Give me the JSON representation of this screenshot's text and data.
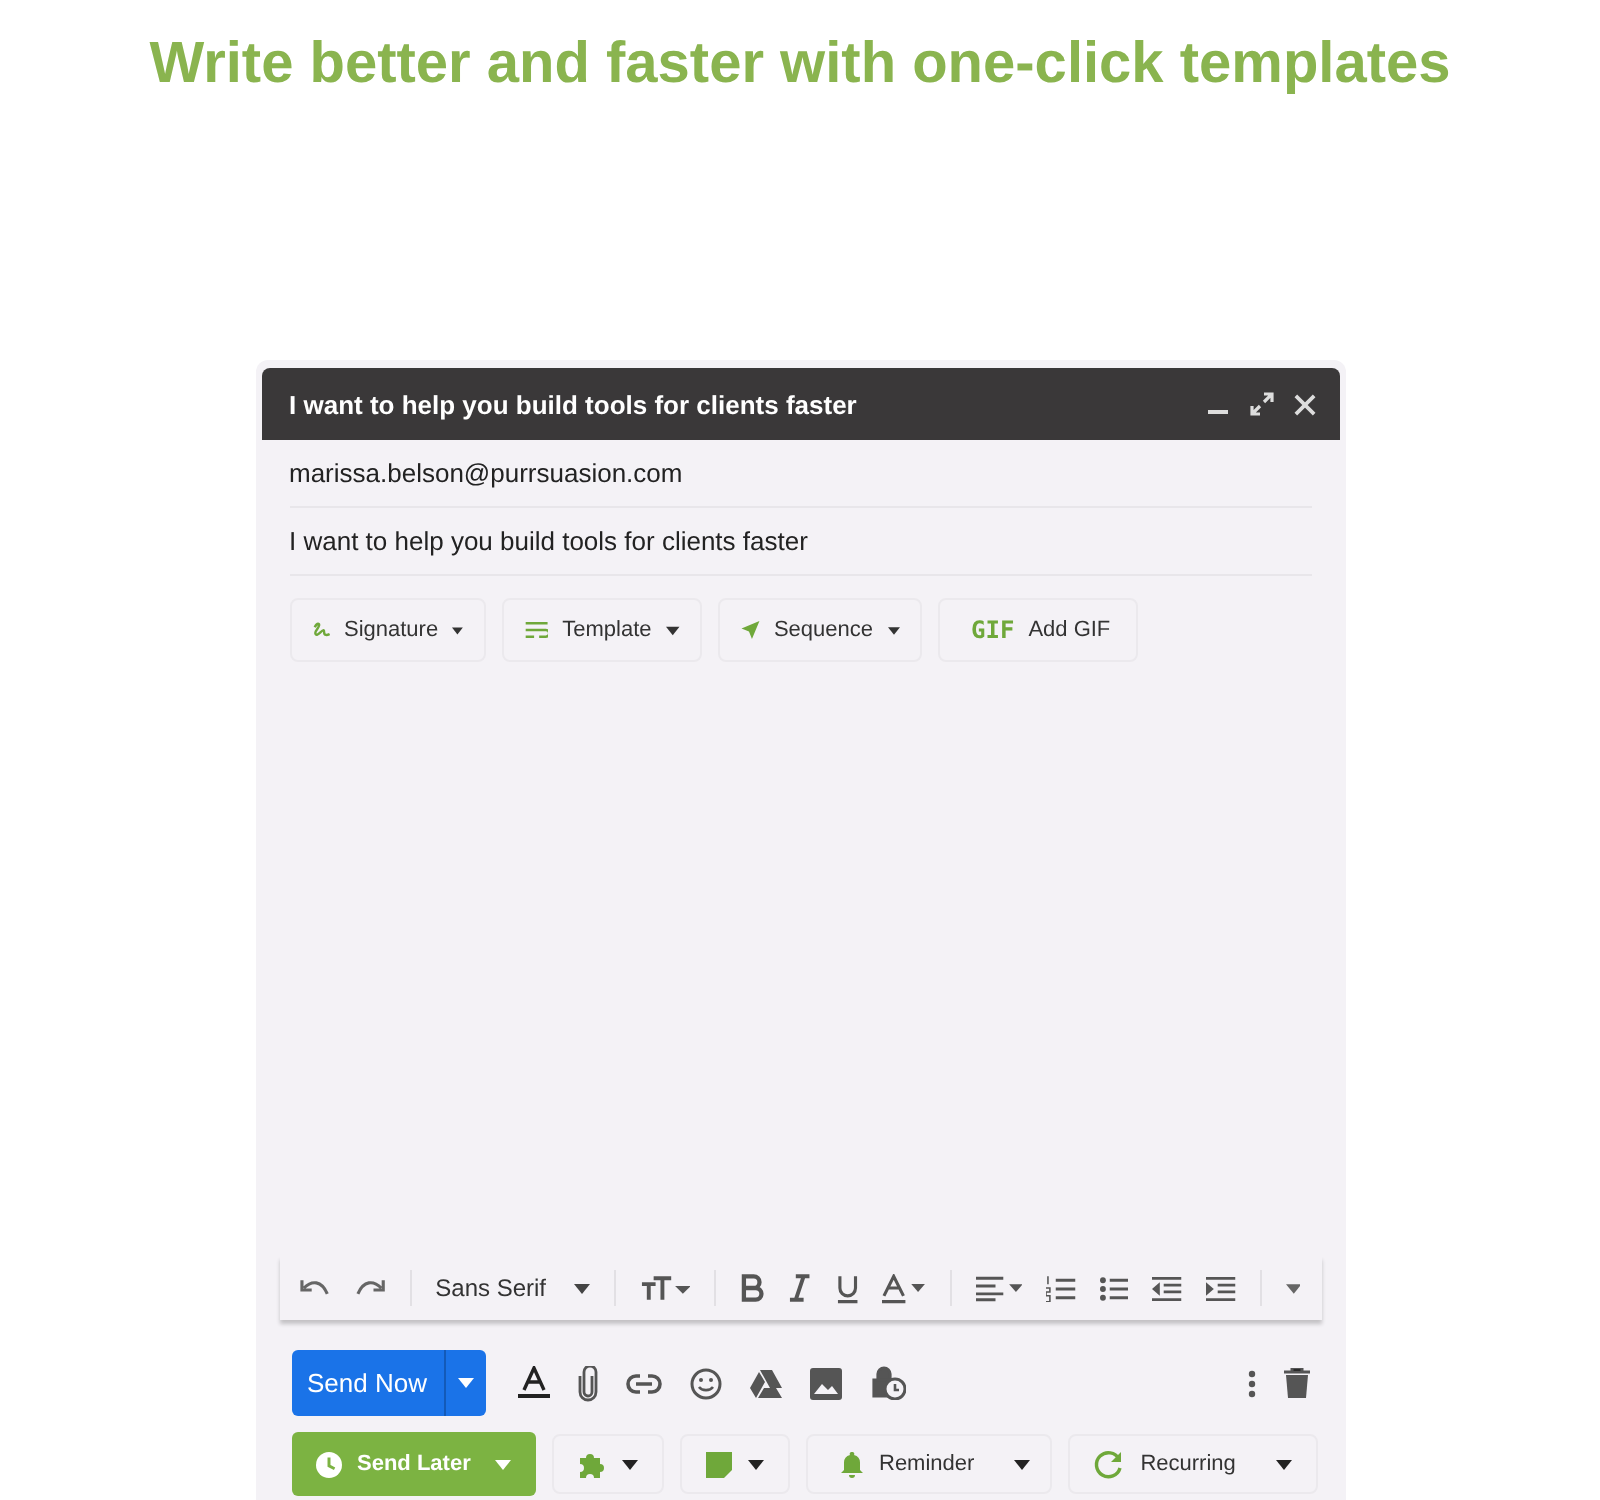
{
  "headline": "Write better and faster with one-click templates",
  "compose": {
    "title": "I want to help you build tools for clients faster",
    "to": "marissa.belson@purrsuasion.com",
    "subject": "I want to help you build tools for clients faster",
    "addons": [
      {
        "kind": "signature",
        "label": "Signature"
      },
      {
        "kind": "template",
        "label": "Template"
      },
      {
        "kind": "sequence",
        "label": "Sequence"
      },
      {
        "kind": "gif",
        "badge": "GIF",
        "label": "Add GIF"
      }
    ],
    "font": "Sans Serif",
    "send_now": "Send Now",
    "send_later": "Send Later",
    "extras": [
      {
        "kind": "puzzle"
      },
      {
        "kind": "note"
      },
      {
        "kind": "reminder",
        "label": "Reminder"
      },
      {
        "kind": "recurring",
        "label": "Recurring"
      }
    ]
  }
}
